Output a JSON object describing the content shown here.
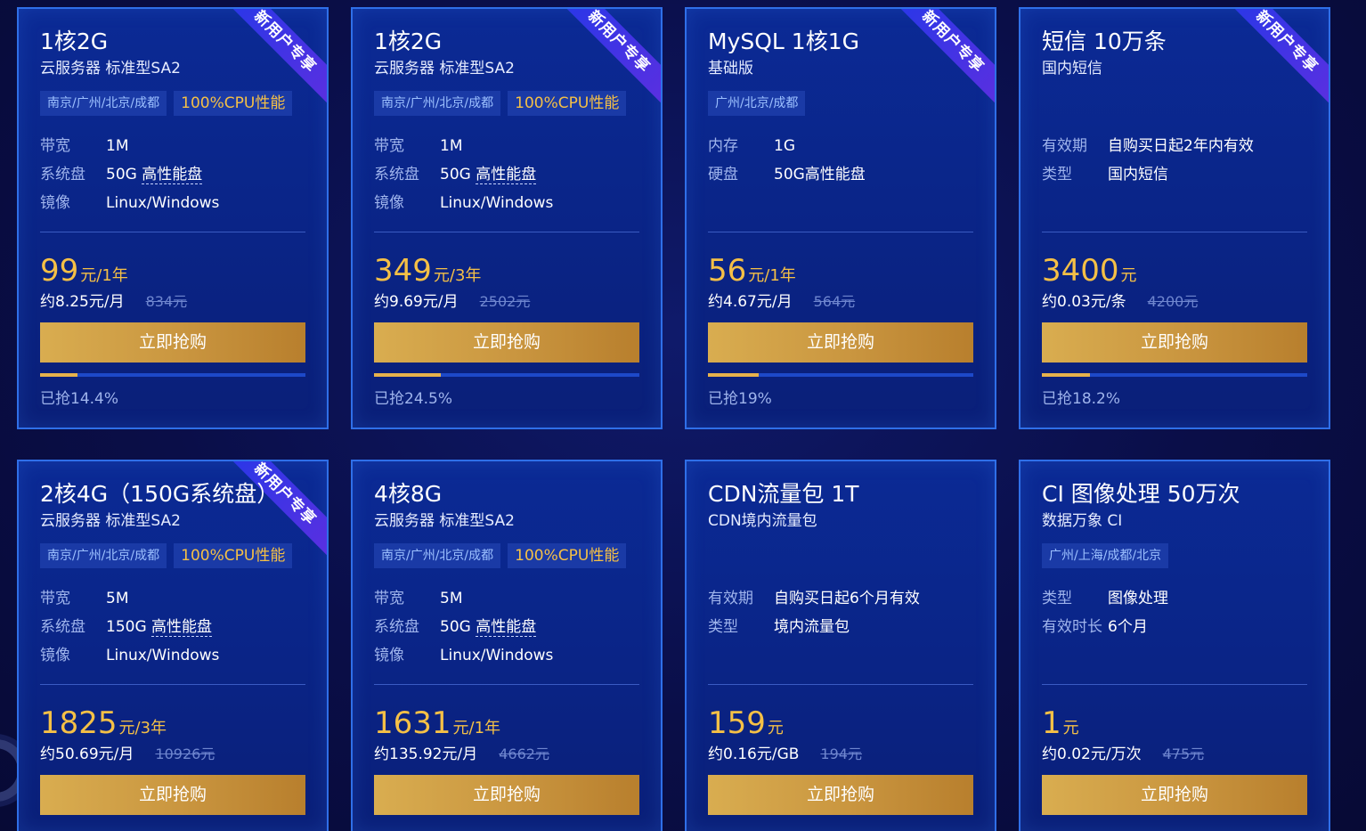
{
  "ribbon_label": "新用户专享",
  "buy_label": "立即抢购",
  "cards": [
    {
      "title": "1核2G",
      "subtitle": "云服务器 标准型SA2",
      "ribbon": true,
      "tags": {
        "location": "南京/广州/北京/成都",
        "cpu": "100%CPU性能"
      },
      "specs": [
        {
          "key": "带宽",
          "value": "1M"
        },
        {
          "key": "系统盘",
          "value": "50G ",
          "value_dotted": "高性能盘"
        },
        {
          "key": "镜像",
          "value": "Linux/Windows"
        }
      ],
      "price": "99",
      "price_unit": "元/1年",
      "per_unit": "约8.25元/月",
      "original": "834元",
      "sold_text": "已抢14.4%",
      "sold_fraction": 0.144
    },
    {
      "title": "1核2G",
      "subtitle": "云服务器 标准型SA2",
      "ribbon": true,
      "tags": {
        "location": "南京/广州/北京/成都",
        "cpu": "100%CPU性能"
      },
      "specs": [
        {
          "key": "带宽",
          "value": "1M"
        },
        {
          "key": "系统盘",
          "value": "50G ",
          "value_dotted": "高性能盘"
        },
        {
          "key": "镜像",
          "value": "Linux/Windows"
        }
      ],
      "price": "349",
      "price_unit": "元/3年",
      "per_unit": "约9.69元/月",
      "original": "2502元",
      "sold_text": "已抢24.5%",
      "sold_fraction": 0.245
    },
    {
      "title": "MySQL 1核1G",
      "subtitle": "基础版",
      "ribbon": true,
      "tags": {
        "location": "广州/北京/成都",
        "cpu": ""
      },
      "specs": [
        {
          "key": "内存",
          "value": "1G"
        },
        {
          "key": "硬盘",
          "value": "50G高性能盘"
        }
      ],
      "price": "56",
      "price_unit": "元/1年",
      "per_unit": "约4.67元/月",
      "original": "564元",
      "sold_text": "已抢19%",
      "sold_fraction": 0.19
    },
    {
      "title": "短信 10万条",
      "subtitle": "国内短信",
      "ribbon": true,
      "tags": {
        "location": "",
        "cpu": ""
      },
      "specs": [
        {
          "key": "有效期",
          "value": "自购买日起2年内有效"
        },
        {
          "key": "类型",
          "value": "国内短信"
        }
      ],
      "price": "3400",
      "price_unit": "元",
      "per_unit": "约0.03元/条",
      "original": "4200元",
      "sold_text": "已抢18.2%",
      "sold_fraction": 0.182
    },
    {
      "title": "2核4G（150G系统盘）",
      "subtitle": "云服务器 标准型SA2",
      "ribbon": true,
      "tags": {
        "location": "南京/广州/北京/成都",
        "cpu": "100%CPU性能"
      },
      "specs": [
        {
          "key": "带宽",
          "value": "5M"
        },
        {
          "key": "系统盘",
          "value": "150G ",
          "value_dotted": "高性能盘"
        },
        {
          "key": "镜像",
          "value": "Linux/Windows"
        }
      ],
      "price": "1825",
      "price_unit": "元/3年",
      "per_unit": "约50.69元/月",
      "original": "10926元"
    },
    {
      "title": "4核8G",
      "subtitle": "云服务器 标准型SA2",
      "ribbon": false,
      "tags": {
        "location": "南京/广州/北京/成都",
        "cpu": "100%CPU性能"
      },
      "specs": [
        {
          "key": "带宽",
          "value": "5M"
        },
        {
          "key": "系统盘",
          "value": "50G ",
          "value_dotted": "高性能盘"
        },
        {
          "key": "镜像",
          "value": "Linux/Windows"
        }
      ],
      "price": "1631",
      "price_unit": "元/1年",
      "per_unit": "约135.92元/月",
      "original": "4662元"
    },
    {
      "title": "CDN流量包 1T",
      "subtitle": "CDN境内流量包",
      "ribbon": false,
      "tags": {
        "location": "",
        "cpu": ""
      },
      "specs": [
        {
          "key": "有效期",
          "value": "自购买日起6个月有效"
        },
        {
          "key": "类型",
          "value": "境内流量包"
        }
      ],
      "price": "159",
      "price_unit": "元",
      "per_unit": "约0.16元/GB",
      "original": "194元"
    },
    {
      "title": "CI 图像处理 50万次",
      "subtitle": "数据万象 CI",
      "ribbon": false,
      "tags": {
        "location": "广州/上海/成都/北京",
        "cpu": ""
      },
      "specs": [
        {
          "key": "类型",
          "value": "图像处理"
        },
        {
          "key": "有效时长",
          "value": "6个月"
        }
      ],
      "price": "1",
      "price_unit": "元",
      "per_unit": "约0.02元/万次",
      "original": "475元"
    }
  ]
}
